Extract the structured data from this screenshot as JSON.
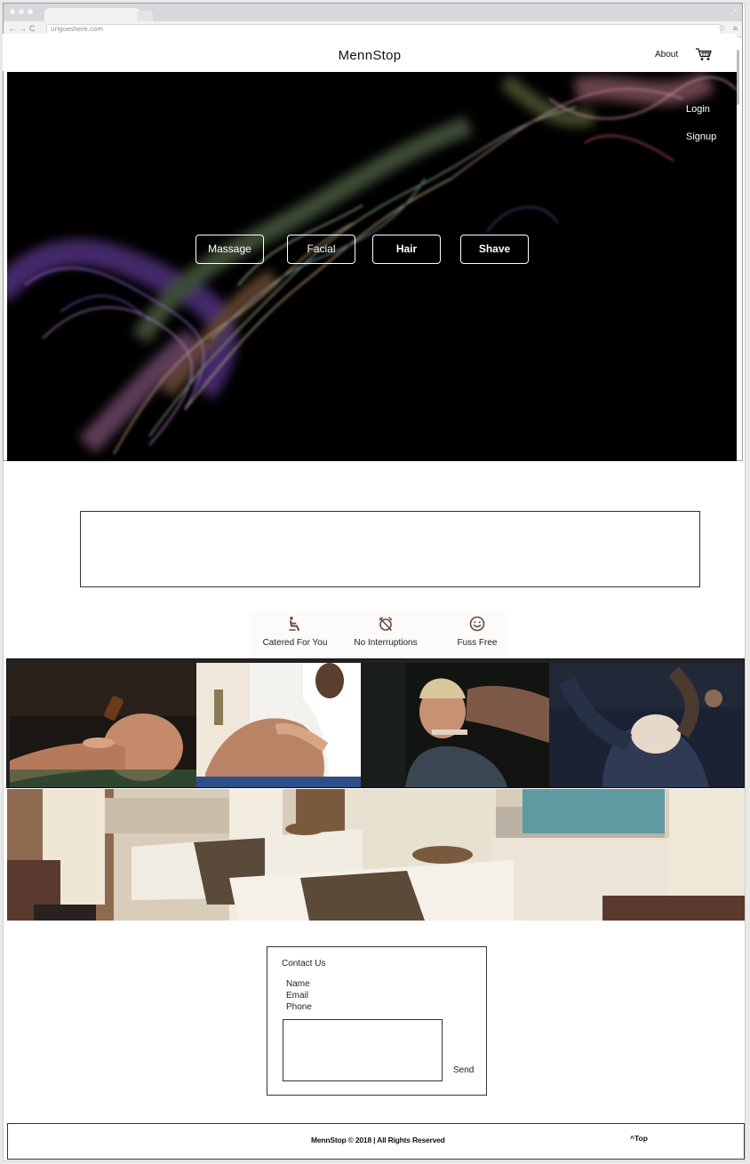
{
  "browser": {
    "url": "urlgoeshere.com"
  },
  "header": {
    "brand": "MennStop",
    "about_label": "About",
    "cart_icon": "cart-icon"
  },
  "hero": {
    "login_label": "Login",
    "signup_label": "Signup",
    "services": [
      {
        "label": "Massage"
      },
      {
        "label": "Facial"
      },
      {
        "label": "Hair"
      },
      {
        "label": "Shave"
      }
    ],
    "background": "#000000"
  },
  "features": [
    {
      "icon": "reclining-seat-icon",
      "label": "Catered For You"
    },
    {
      "icon": "alarm-off-icon",
      "label": "No Interruptions"
    },
    {
      "icon": "smiley-face-icon",
      "label": "Fuss Free"
    }
  ],
  "contact": {
    "title": "Contact Us",
    "fields": [
      "Name",
      "Email",
      "Phone"
    ],
    "send_label": "Send"
  },
  "footer": {
    "copyright": "MennStop © 2018  |  All Rights Reserved",
    "top_label": "Top"
  },
  "colors": {
    "accent": "#000000",
    "text": "#222222",
    "border": "#333333"
  }
}
